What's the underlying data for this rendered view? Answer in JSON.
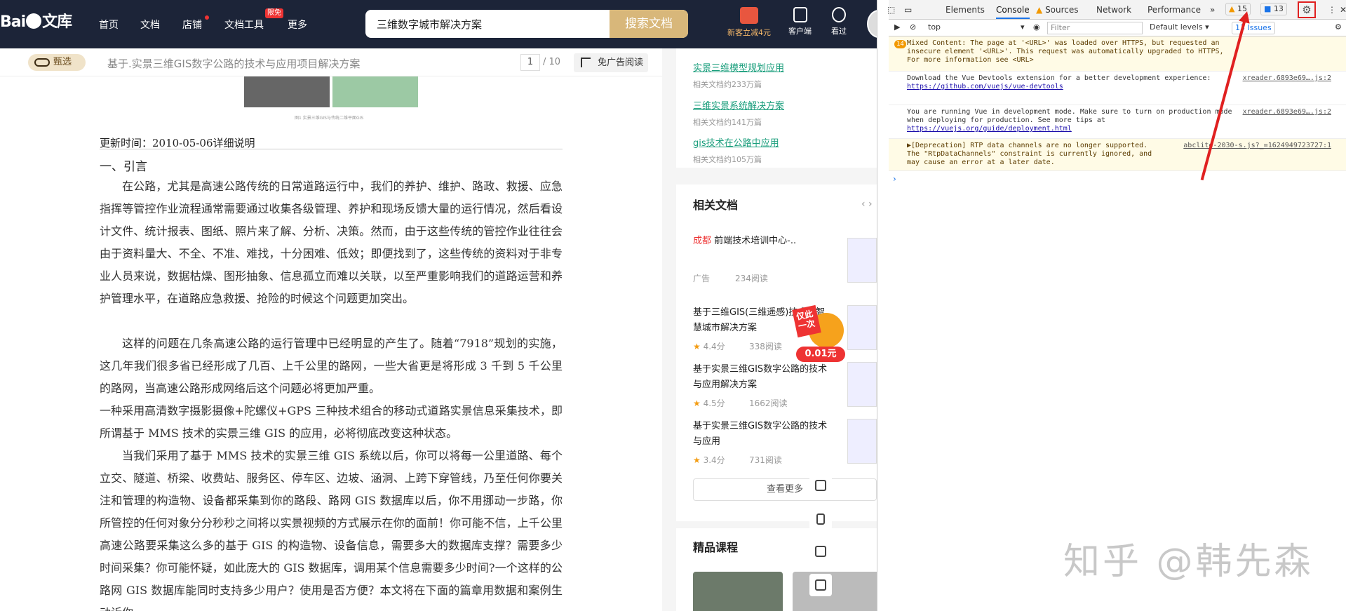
{
  "topbar": {
    "logo_text": "Bai",
    "logo_text2": "文库",
    "nav": [
      "首页",
      "文档",
      "店铺",
      "文档工具",
      "更多"
    ],
    "nav_badge": "限免",
    "search_value": "三维数字城市解决方案",
    "search_button": "搜索文档",
    "vip_label": "新客立减4元",
    "client_label": "客户端",
    "history_label": "看过"
  },
  "subbar": {
    "tag": "甄选",
    "title": "基于.实景三维GIS数字公路的技术与应用项目解决方案",
    "page_current": "1",
    "page_total": "/ 10",
    "adfree": "免广告阅读"
  },
  "doc": {
    "caption": "图1 实景三维GIS与传统二维平面GIS",
    "updated": "更新时间：2010-05-06详细说明",
    "heading": "一、引言",
    "p1": "在公路，尤其是高速公路传统的日常道路运行中，我们的养护、维护、路政、救援、应急指挥等管控作业流程通常需要通过收集各级管理、养护和现场反馈大量的运行情况，然后看设计文件、统计报表、图纸、照片来了解、分析、决策。然而，由于这些传统的管控作业往往会由于资料量大、不全、不准、难找，十分困难、低效；即便找到了，这些传统的资料对于非专业人员来说，数据枯燥、图形抽象、信息孤立而难以关联，以至严重影响我们的道路运营和养护管理水平，在道路应急救援、抢险的时候这个问题更加突出。",
    "p2": "这样的问题在几条高速公路的运行管理中已经明显的产生了。随着“7918”规划的实施，这几年我们很多省已经形成了几百、上千公里的路网，一些大省更是将形成 3 千到 5 千公里的路网，当高速公路形成网络后这个问题必将更加严重。",
    "p3": "一种采用高清数字摄影摄像+陀螺仪+GPS 三种技术组合的移动式道路实景信息采集技术，即所谓基于 MMS 技术的实景三维 GIS 的应用，必将彻底改变这种状态。",
    "p4": "当我们采用了基于 MMS 技术的实景三维 GIS 系统以后，你可以将每一公里道路、每个立交、隧道、桥梁、收费站、服务区、停车区、边坡、涵洞、上跨下穿管线，乃至任何你要关注和管理的构造物、设备都采集到你的路段、路网 GIS 数据库以后，你不用挪动一步路，你所管控的任何对象分分秒秒之间将以实景视频的方式展示在你的面前！你可能不信，上千公里高速公路要采集这么多的基于 GIS 的构造物、设备信息，需要多大的数据库支撑？需要多少时间采集？你可能怀疑，如此庞大的 GIS 数据库，调用某个信息需要多少时间?一个这样的公路网 GIS 数据库能同时支持多少用户？使用是否方便？本文将在下面的篇章用数据和案例生动诉你"
  },
  "related_top": [
    {
      "title": "实景三维模型规划应用",
      "meta": "相关文档约233万篇"
    },
    {
      "title": "三维实景系统解决方案",
      "meta": "相关文档约141万篇"
    },
    {
      "title": "gis技术在公路中应用",
      "meta": "相关文档约105万篇"
    }
  ],
  "related": {
    "heading": "相关文档",
    "items": [
      {
        "title_prefix": "成都",
        "title": "前端技术培训中心-..",
        "meta1": "广告",
        "meta2": "234阅读"
      },
      {
        "title": "基于三维GIS(三维遥感)技术的智慧城市解决方案",
        "rating": "4.4分",
        "reads": "338阅读"
      },
      {
        "title": "基于实景三维GIS数字公路的技术与应用解决方案",
        "rating": "4.5分",
        "reads": "1662阅读"
      },
      {
        "title": "基于实景三维GIS数字公路的技术与应用",
        "rating": "3.4分",
        "reads": "731阅读"
      }
    ],
    "more": "查看更多"
  },
  "promo": {
    "tag": "仅此一次",
    "price": "0.01元"
  },
  "courses": {
    "heading": "精品课程"
  },
  "devtools": {
    "tabs": [
      "Elements",
      "Console",
      "Sources",
      "Network",
      "Performance"
    ],
    "warn_count": "15",
    "msg_count": "13",
    "context": "top",
    "filter_placeholder": "Filter",
    "levels": "Default levels",
    "issues": "13 Issues",
    "messages": [
      {
        "count": "14",
        "text": "Mixed Content: The page at '<URL>' was loaded over HTTPS, but requested an insecure element '<URL>'. This request was automatically upgraded to HTTPS, For more information see <URL>"
      },
      {
        "text": "Download the Vue Devtools extension for a better development experience:",
        "link": "https://github.com/vuejs/vue-devtools",
        "src": "xreader.6893e69….js:2"
      },
      {
        "text": "You are running Vue in development mode. Make sure to turn on production mode when deploying for production. See more tips at",
        "link": "https://vuejs.org/guide/deployment.html",
        "src": "xreader.6893e69….js:2"
      },
      {
        "text": "▶[Deprecation] RTP data channels are no longer supported. The \"RtpDataChannels\" constraint is currently ignored, and may cause an error at a later date.",
        "src": "abclite-2030-s.js?_=1624949723727:1"
      }
    ]
  },
  "watermark": "知乎 @韩先森",
  "colors": {
    "accent": "#1a9e7c",
    "search_button": "#d8b77a",
    "highlight": "#e02020",
    "topbar": "#1c2438"
  },
  "icons": [
    "gift-icon",
    "mobile-icon",
    "clock-icon",
    "gear-icon",
    "inspect-icon",
    "device-icon",
    "clear-icon",
    "eye-icon"
  ]
}
